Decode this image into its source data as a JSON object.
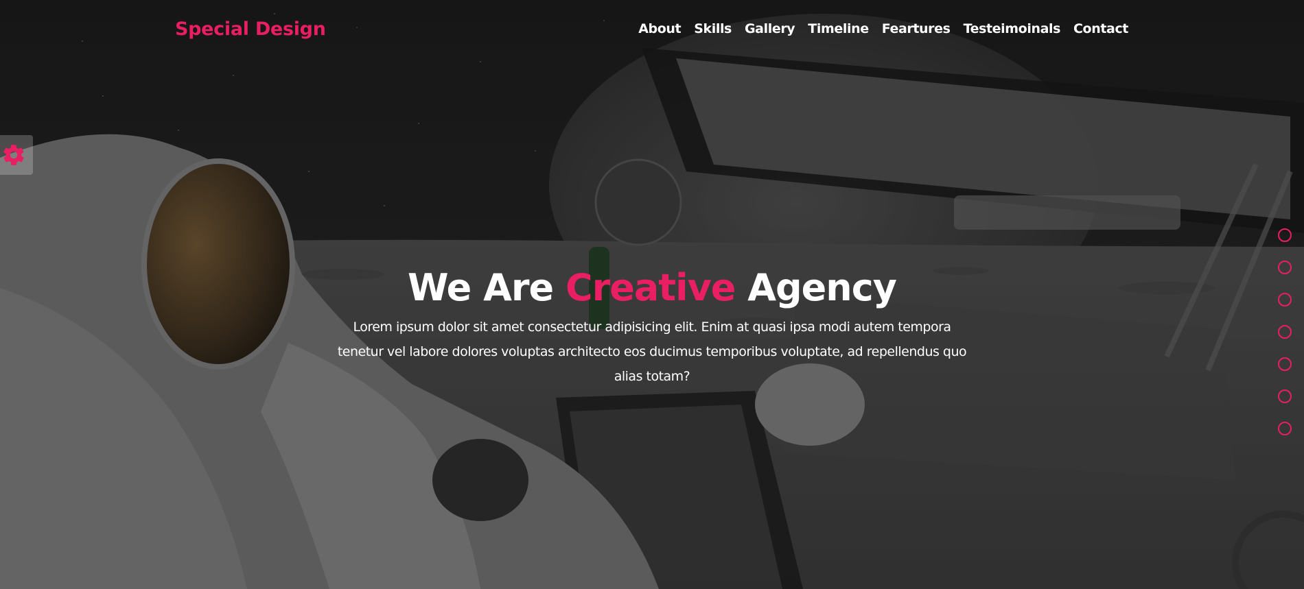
{
  "header": {
    "logo": "Special Design",
    "nav": [
      {
        "label": "About"
      },
      {
        "label": "Skills"
      },
      {
        "label": "Gallery"
      },
      {
        "label": "Timeline"
      },
      {
        "label": "Feartures"
      },
      {
        "label": "Testeimoinals"
      },
      {
        "label": "Contact"
      }
    ]
  },
  "intro": {
    "title_prefix": "We Are",
    "title_accent": "Creative",
    "title_suffix": "Agency",
    "description": "Lorem ipsum dolor sit amet consectetur adipisicing elit. Enim at quasi ipsa modi autem tempora tenetur vel labore dolores voluptas architecto eos ducimus temporibus voluptate, ad repellendus quo alias totam?"
  },
  "settings": {
    "icon": "gear-icon"
  },
  "bullets": [
    {
      "section": "About"
    },
    {
      "section": "Skills"
    },
    {
      "section": "Gallery"
    },
    {
      "section": "Timeline"
    },
    {
      "section": "Feartures"
    },
    {
      "section": "Testeimoinals"
    },
    {
      "section": "Contact"
    }
  ],
  "colors": {
    "accent": "#e91e63",
    "text": "#ffffff"
  }
}
